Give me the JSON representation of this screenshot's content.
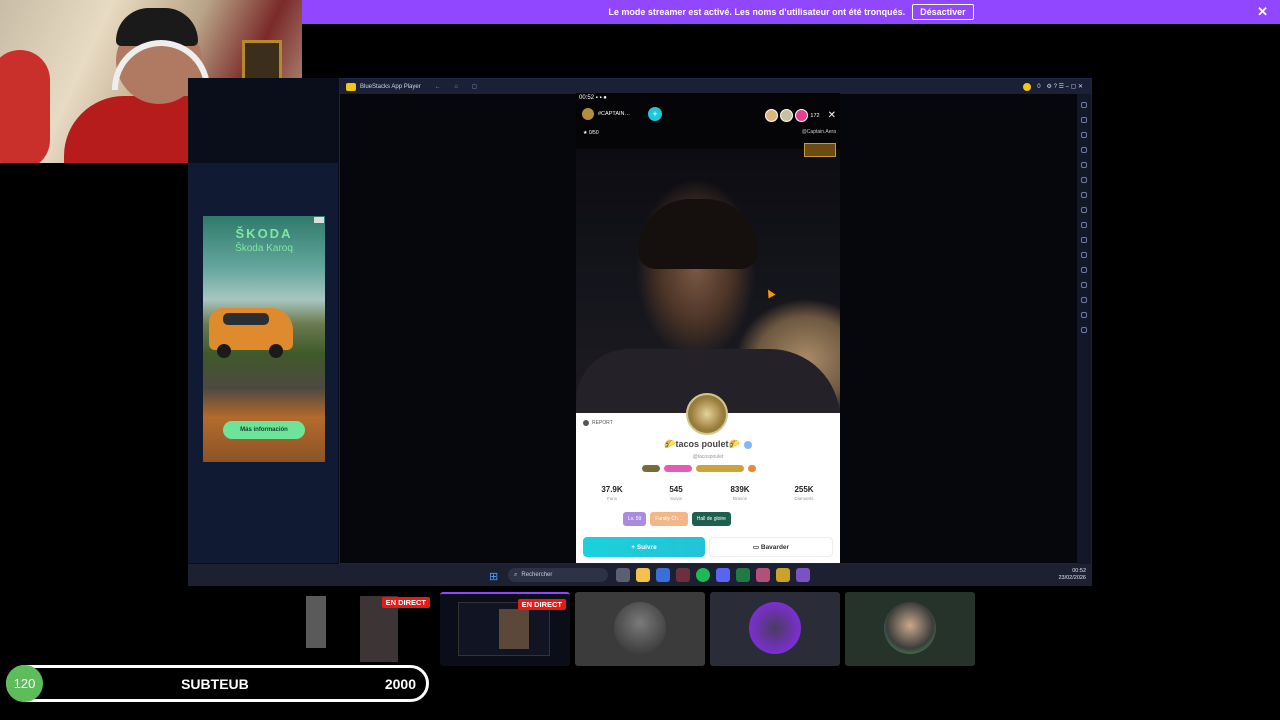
{
  "banner": {
    "message": "Le mode streamer est activé. Les noms d'utilisateur ont été tronqués.",
    "button": "Désactiver",
    "close": "✕"
  },
  "bluestacks": {
    "title": "BlueStacks App Player",
    "nav": "← ⌂ ▢",
    "coins": "0"
  },
  "tiktok": {
    "status_time": "00:52",
    "host_name": "#CAPTAIN…",
    "participants": "0/50",
    "viewer_count": "172",
    "handle": "@Captain.Aera",
    "close": "✕",
    "plus": "+",
    "profile": {
      "report": "REPORT",
      "display_name": "🌮tacos poulet🌮",
      "stats": [
        {
          "value": "37.9K",
          "label": "Fans"
        },
        {
          "value": "545",
          "label": "Suivis"
        },
        {
          "value": "839K",
          "label": "Bravos"
        },
        {
          "value": "255K",
          "label": "Diamants"
        }
      ],
      "tags": [
        "Lv. 59",
        "Family Ch…",
        "Hall de gloire"
      ],
      "follow": "+ Suivre",
      "chat": "Bavarder"
    }
  },
  "taskbar": {
    "search": "Rechercher",
    "time": "00:52",
    "date": "23/02/2026"
  },
  "ad": {
    "brand": "ŠKODA",
    "model": "Škoda Karoq",
    "cta": "Más información"
  },
  "cards": {
    "live_label": "EN DIRECT"
  },
  "subgoal": {
    "current": "120",
    "label": "SUBTEUB",
    "target": "2000",
    "progress": 0.06
  },
  "colors": {
    "twitch_purple": "#9146ff",
    "live_red": "#e91916",
    "follow_cyan": "#1cd0dc",
    "goal_green": "#5cbd5a"
  }
}
